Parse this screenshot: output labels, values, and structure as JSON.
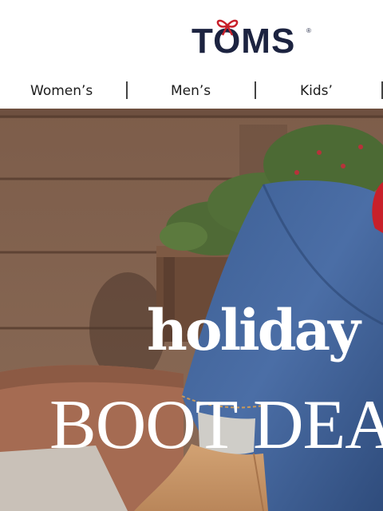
{
  "brand": {
    "logo_text": "TOMS",
    "registered_mark": "®"
  },
  "nav": {
    "items": [
      {
        "label": "Women’s"
      },
      {
        "label": "Men’s"
      },
      {
        "label": "Kids’"
      }
    ]
  },
  "hero": {
    "headline_1": "holiday",
    "headline_2": "BOOT DEALS"
  },
  "colors": {
    "brand_navy": "#1c2340",
    "bow_red": "#c8202a"
  },
  "icons": {
    "logo_bow": "ribbon-bow-icon"
  }
}
